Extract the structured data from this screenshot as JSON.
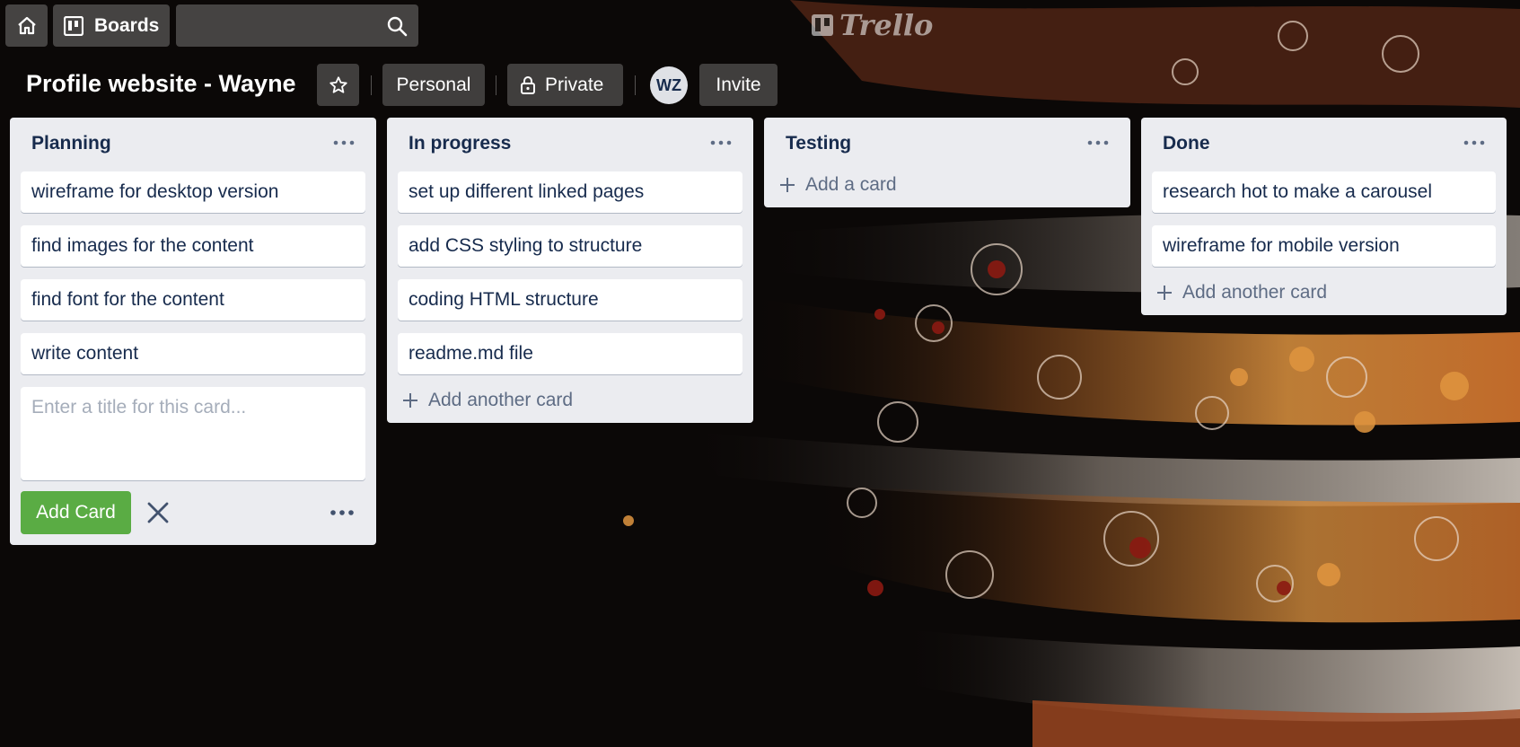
{
  "nav": {
    "boards_label": "Boards",
    "search_placeholder": "",
    "logo_text": "Trello"
  },
  "board": {
    "title": "Profile website - Wayne",
    "visibility_team": "Personal",
    "visibility_privacy": "Private",
    "member_initials": "WZ",
    "invite_label": "Invite"
  },
  "lists": [
    {
      "title": "Planning",
      "cards": [
        "wireframe for desktop version",
        "find images for the content",
        "find font for the content",
        "write content"
      ],
      "composer_placeholder": "Enter a title for this card...",
      "composer_submit": "Add Card"
    },
    {
      "title": "In progress",
      "cards": [
        "set up different linked pages",
        "add CSS styling to structure",
        "coding HTML structure",
        "readme.md file"
      ],
      "add_label": "Add another card"
    },
    {
      "title": "Testing",
      "cards": [],
      "add_label": "Add a card"
    },
    {
      "title": "Done",
      "cards": [
        "research hot to make a carousel",
        "wireframe for mobile version"
      ],
      "add_label": "Add another card"
    }
  ],
  "colors": {
    "list_bg": "#ebecf0",
    "card_text": "#172b4d",
    "add_button": "#5aac44",
    "muted_text": "#5e6c84"
  }
}
